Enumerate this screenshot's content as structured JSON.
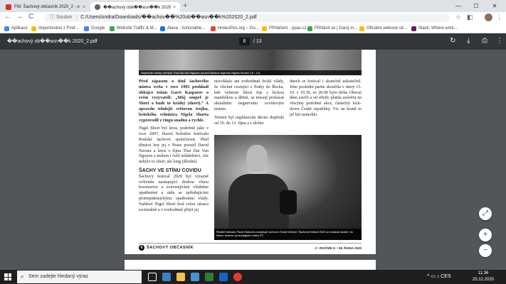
{
  "browser": {
    "tabs": [
      {
        "title": "FW: Šachový občasník 2020_2 - o",
        "close": "×"
      },
      {
        "title": "��achový obě��asn��k 2020",
        "close": "×"
      }
    ],
    "new_tab": "+",
    "window_controls": {
      "minimize": "—",
      "maximize": "☐",
      "close": "✕"
    },
    "nav": {
      "back": "←",
      "forward": "→",
      "reload": "C"
    },
    "address": {
      "info_label": "Soubor",
      "url": "C:/Users/ondra/Downloads/��achov��%20ob��asn��k%202020_2.pdf"
    },
    "bookmarks": [
      {
        "label": "Aplikace",
        "color": "#4285f4"
      },
      {
        "label": "Importováno z Firef...",
        "color": "#fbbc04"
      },
      {
        "label": "Google",
        "color": "#4285f4"
      },
      {
        "label": "Website Traffic & M...",
        "color": "#34a853"
      },
      {
        "label": "Alexa - Actionable...",
        "color": "#1a73e8"
      },
      {
        "label": "HrdaciPes.org – Go...",
        "color": "#ea4335"
      },
      {
        "label": "Přihlášení - ppas.cz",
        "color": "#fbbc04"
      },
      {
        "label": "Přihlásit se | Daruj m...",
        "color": "#34a853"
      },
      {
        "label": "Oficiální webové str...",
        "color": "#fbbc04"
      },
      {
        "label": "Slack: Where work...",
        "color": "#611f69"
      }
    ]
  },
  "pdf": {
    "title": "��achový ob��asn��k 2020_2.pdf",
    "current_page": "6",
    "total_pages": "/ 13",
    "icons": {
      "menu": "☰",
      "rotate": "↻",
      "download": "⤓",
      "print": "⎙",
      "more": "⋮"
    }
  },
  "article": {
    "top_caption": "Nejmladší český velmistr Thai Dai Van Nguyen porazil britskou legendu Nigela Shorta 3,5 : 4,5.",
    "col1_bold": "Před zápasem o titul šachového mistra světa v roce 1993 prohlásil obhájce trůnu Garri Kasparov o svém vyzyvateli: „Můj soupeř je Short a bude to krátký (short).“ A opravdu tehdejší světovou trojku, britského velmistra Nigela Shorta vyprovodil z ringu snadno a rychle.",
    "col1_p2": "Nigel Short byl letos, podobně jako v roce 2007, hlavní hvězdou festivalu Pražské šachové společnosti. Před třinácti lety jej v Praze porazil David Navara a letos v fíjnu Thai Dai Van Nguyen a málem i čelil mládežníci. Ale nebylo to short, ale long (dlouhé).",
    "col1_heading": "ŠACHY VE STÍNU COVIDU",
    "col1_p3": "Šachový festival 2020 byl výrazně ovlivněn nastupující druhou vlnou koronaviru a souvisejícími vládními opatřeními a stále se zpřísňujícími protiepidemickými opatřeními vlády. Naštěstí Nigel Short bral celou situaci racionálně a v rozhodnutí přijet jej",
    "col2_top": "nezviklalo ani rozhodnutí řecké vlády, že všichni cestující z Prahy do Řecka, kde velmistr Short žije s řeckou manželkou a dětmi, se musejí prokázat aktuálním negativním covidovým testem.",
    "col2_p2": "Termín byl naplánován dávno dopředu od 10. do 13. října a v těchto",
    "col3_top": "dnech se festival i skutečně uskutečnil. Jeho poslední partie skončila v úterý 13. 10. v 19.30, ve 20.00 bylo třeba Obecní dům zavřít a od středy platila uzávěra na všechny podobné akce, částečný lock-down České republiky. Víc na hraně to již být nemohlo.",
    "photo_caption": "Ředitel festivalu Pavel Matocha poskytuje rozhovor České televizi. Šachový festival 2020 se dokázal dostat i do hlavní večerní zpravodajské relace ČT.",
    "footer": {
      "page": "6",
      "magazine": "ŠACHOVÝ OBČASNÍK",
      "issue": "2 • ROČNÍK II. • 28. ŘÍJNA 2020"
    }
  },
  "zoom_controls": {
    "fit": "⤢",
    "zoom_in": "+",
    "zoom_out": "−"
  },
  "taskbar": {
    "search_placeholder": "Sem zadejte hledaný výraz",
    "language": "CES",
    "time": "11:36",
    "date": "20.12.2020"
  }
}
